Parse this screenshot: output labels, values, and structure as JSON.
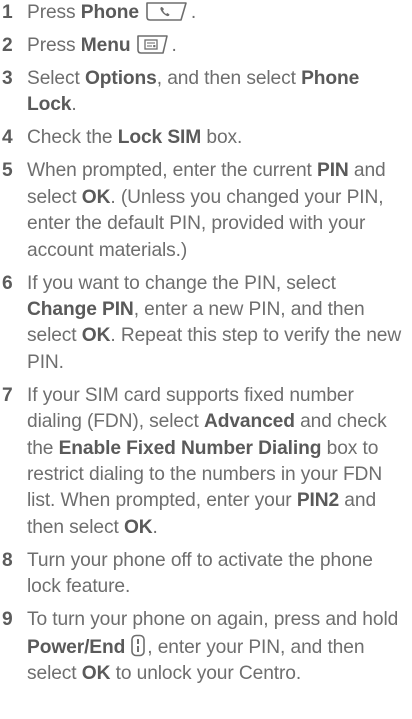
{
  "steps": [
    {
      "num": "1",
      "parts": [
        {
          "t": "Press "
        },
        {
          "t": "Phone",
          "b": true
        },
        {
          "key": "phone-key-icon"
        },
        {
          "t": "."
        }
      ]
    },
    {
      "num": "2",
      "parts": [
        {
          "t": "Press "
        },
        {
          "t": "Menu",
          "b": true
        },
        {
          "key": "menu-key-icon"
        },
        {
          "t": "."
        }
      ]
    },
    {
      "num": "3",
      "parts": [
        {
          "t": "Select "
        },
        {
          "t": "Options",
          "b": true
        },
        {
          "t": ", and then select "
        },
        {
          "t": "Phone Lock",
          "b": true
        },
        {
          "t": "."
        }
      ]
    },
    {
      "num": "4",
      "parts": [
        {
          "t": "Check the "
        },
        {
          "t": "Lock SIM",
          "b": true
        },
        {
          "t": " box."
        }
      ]
    },
    {
      "num": "5",
      "parts": [
        {
          "t": "When prompted, enter the current "
        },
        {
          "t": "PIN",
          "b": true
        },
        {
          "t": " and select "
        },
        {
          "t": "OK",
          "b": true
        },
        {
          "t": ". (Unless you changed your  PIN, enter the default PIN, provided with your account  materials.)"
        }
      ]
    },
    {
      "num": "6",
      "parts": [
        {
          "t": "If you want to change the PIN, select "
        },
        {
          "t": "Change PIN",
          "b": true
        },
        {
          "t": ", enter a new PIN, and then select "
        },
        {
          "t": "OK",
          "b": true
        },
        {
          "t": ". Repeat this step to verify the new PIN."
        }
      ]
    },
    {
      "num": "7",
      "parts": [
        {
          "t": "If your SIM card supports fixed number dialing (FDN), select "
        },
        {
          "t": "Advanced",
          "b": true
        },
        {
          "t": " and check the "
        },
        {
          "t": "Enable Fixed Number Dialing",
          "b": true
        },
        {
          "t": " box to restrict dialing to the numbers in your FDN list. When prompted, enter your "
        },
        {
          "t": "PIN2",
          "b": true
        },
        {
          "t": " and then select "
        },
        {
          "t": "OK",
          "b": true
        },
        {
          "t": "."
        }
      ]
    },
    {
      "num": "8",
      "parts": [
        {
          "t": "Turn your phone off to activate the phone lock feature."
        }
      ]
    },
    {
      "num": "9",
      "parts": [
        {
          "t": "To turn your phone on again, press and hold "
        },
        {
          "t": "Power/End",
          "b": true
        },
        {
          "key": "power-end-key-icon"
        },
        {
          "t": ", enter your PIN, and then select "
        },
        {
          "t": "OK",
          "b": true
        },
        {
          "t": " to unlock your Centro."
        }
      ]
    }
  ]
}
